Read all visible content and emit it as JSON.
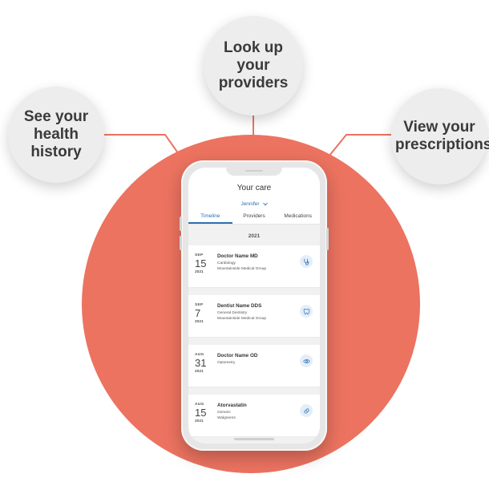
{
  "callouts": {
    "left": "See your health history",
    "center": "Look up your providers",
    "right": "View your prescriptions"
  },
  "colors": {
    "accent_circle": "#ec7360",
    "link_blue": "#2f6fb3",
    "bubble_bg": "#ededed"
  },
  "app": {
    "title": "Your care",
    "user": "Jennifer",
    "tabs": [
      {
        "label": "Timeline",
        "active": true
      },
      {
        "label": "Providers",
        "active": false
      },
      {
        "label": "Medications",
        "active": false
      }
    ],
    "year_header": "2021",
    "entries": [
      {
        "month": "SEP",
        "day": "15",
        "year": "2021",
        "name": "Doctor Name MD",
        "line1": "Cardiology",
        "line2": "Mountainside Medical Group",
        "icon": "stethoscope-icon"
      },
      {
        "month": "SEP",
        "day": "7",
        "year": "2021",
        "name": "Dentist Name DDS",
        "line1": "General Dentistry",
        "line2": "Mountainside Medical Group",
        "icon": "tooth-icon"
      },
      {
        "month": "AUG",
        "day": "31",
        "year": "2021",
        "name": "Doctor Name OD",
        "line1": "Optometry",
        "line2": "",
        "icon": "eye-icon"
      },
      {
        "month": "AUG",
        "day": "15",
        "year": "2021",
        "name": "Atorvastatin",
        "line1": "Generic",
        "line2": "Walgreens",
        "icon": "pill-icon"
      }
    ]
  }
}
